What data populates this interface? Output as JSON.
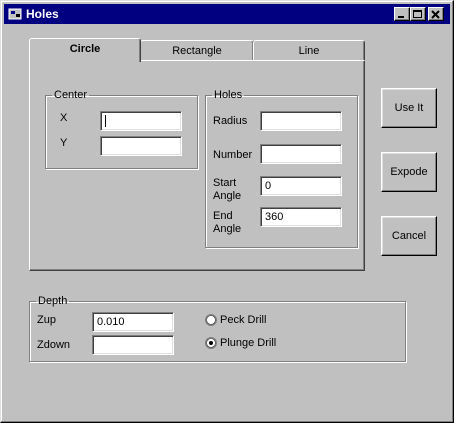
{
  "window": {
    "title": "Holes"
  },
  "tabs": [
    {
      "label": "Circle",
      "selected": true
    },
    {
      "label": "Rectangle",
      "selected": false
    },
    {
      "label": "Line",
      "selected": false
    }
  ],
  "center": {
    "legend": "Center",
    "x_label": "X",
    "x_value": "",
    "y_label": "Y",
    "y_value": ""
  },
  "holes": {
    "legend": "Holes",
    "radius_label": "Radius",
    "radius_value": "",
    "number_label": "Number",
    "number_value": "",
    "start_label_1": "Start",
    "start_label_2": "Angle",
    "start_value": "0",
    "end_label_1": "End",
    "end_label_2": "Angle",
    "end_value": "360"
  },
  "buttons": {
    "use_it": "Use It",
    "expode": "Expode",
    "cancel": "Cancel"
  },
  "depth": {
    "legend": "Depth",
    "zup_label": "Zup",
    "zup_value": "0.010",
    "zdown_label": "Zdown",
    "zdown_value": "",
    "peck_label": "Peck Drill",
    "peck_selected": false,
    "plunge_label": "Plunge Drill",
    "plunge_selected": true
  }
}
